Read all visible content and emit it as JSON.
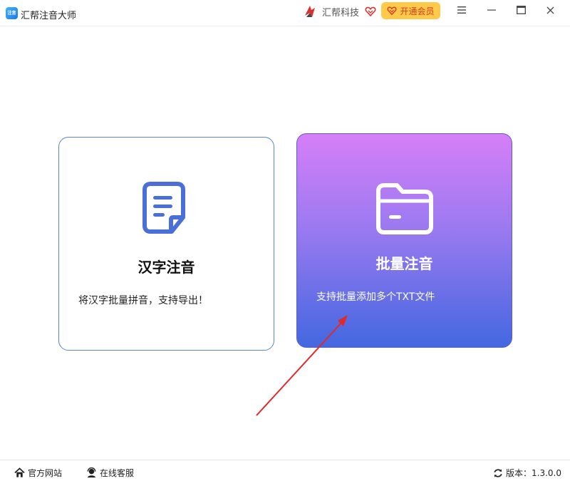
{
  "window": {
    "app_title": "汇帮注音大师",
    "logo_text": "注音"
  },
  "header": {
    "brand_name": "汇帮科技",
    "vip_label": "开通会员"
  },
  "cards": [
    {
      "title": "汉字注音",
      "description": "将汉字批量拼音，支持导出！",
      "icon": "document-icon"
    },
    {
      "title": "批量注音",
      "description": "支持批量添加多个TXT文件",
      "icon": "folder-icon"
    }
  ],
  "footer": {
    "website_label": "官方网站",
    "support_label": "在线客服",
    "version_label": "版本：",
    "version_value": "1.3.0.0"
  },
  "colors": {
    "accent_blue": "#4a6fd8",
    "vip_yellow": "#ffc94a",
    "vip_red": "#d23b20",
    "gradient_top": "#d67ff8",
    "gradient_bottom": "#4368e0",
    "arrow_red": "#e02a2a"
  }
}
